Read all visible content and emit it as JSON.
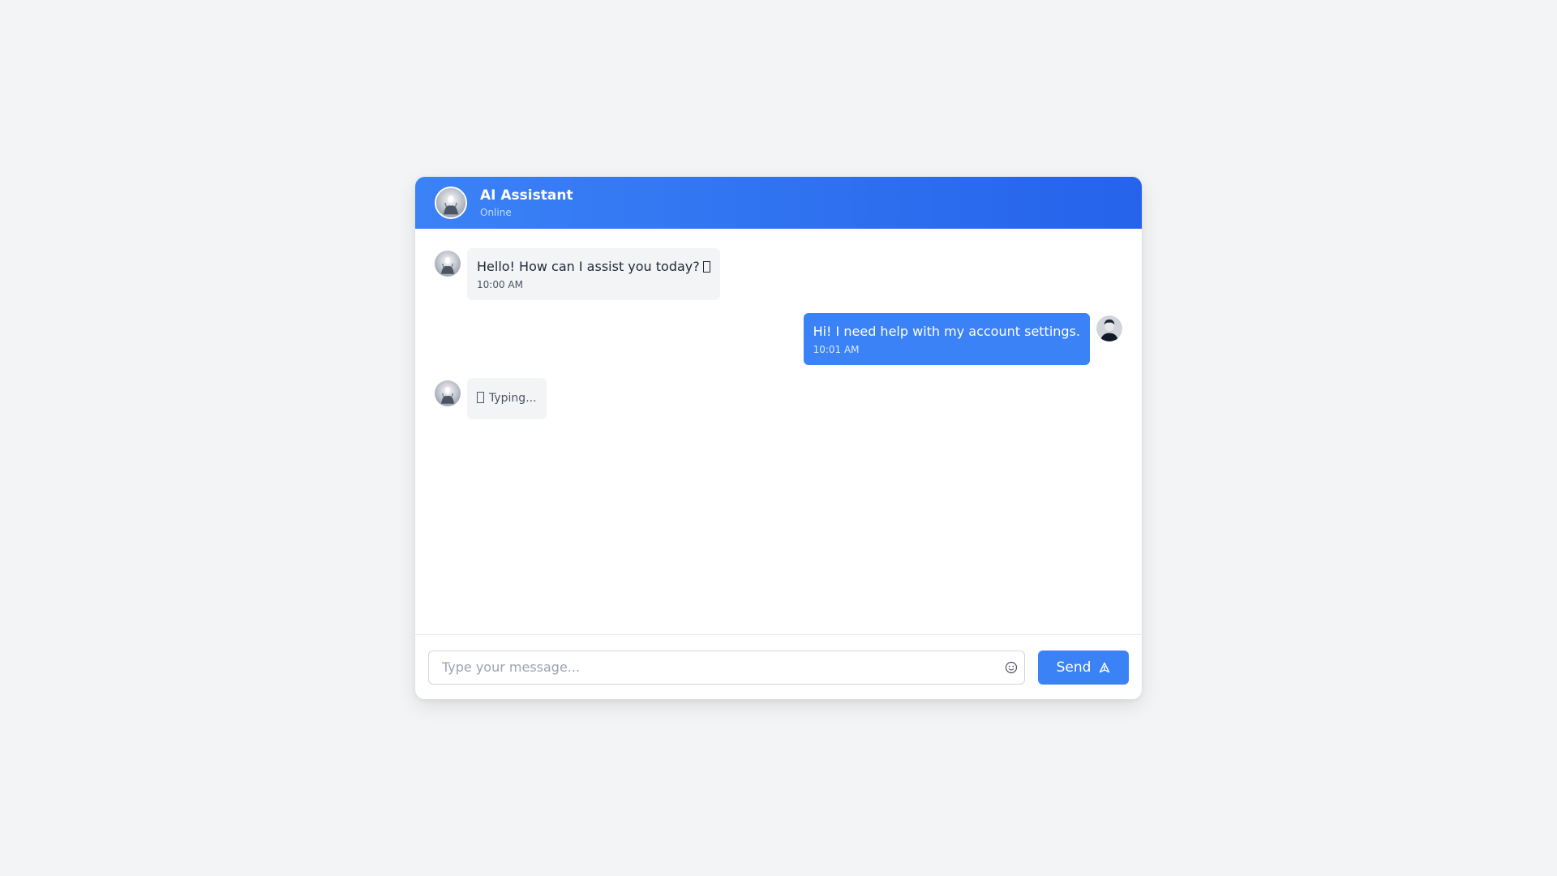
{
  "header": {
    "title": "AI Assistant",
    "status": "Online"
  },
  "messages": [
    {
      "sender": "bot",
      "text": "Hello! How can I assist you today?",
      "time": "10:00 AM"
    },
    {
      "sender": "user",
      "text": "Hi! I need help with my account settings.",
      "time": "10:01 AM"
    }
  ],
  "typing": {
    "text": "Typing..."
  },
  "composer": {
    "placeholder": "Type your message...",
    "send_label": "Send"
  },
  "icons": {
    "bot_avatar": "robot-avatar-icon",
    "user_avatar": "user-avatar-icon",
    "emoji": "smiley-icon",
    "send": "send-icon"
  },
  "colors": {
    "accent": "#3b82f6",
    "header_start": "#3b82f6",
    "header_end": "#2563eb",
    "page_bg": "#f3f4f6",
    "bot_bubble": "#f3f4f6"
  }
}
